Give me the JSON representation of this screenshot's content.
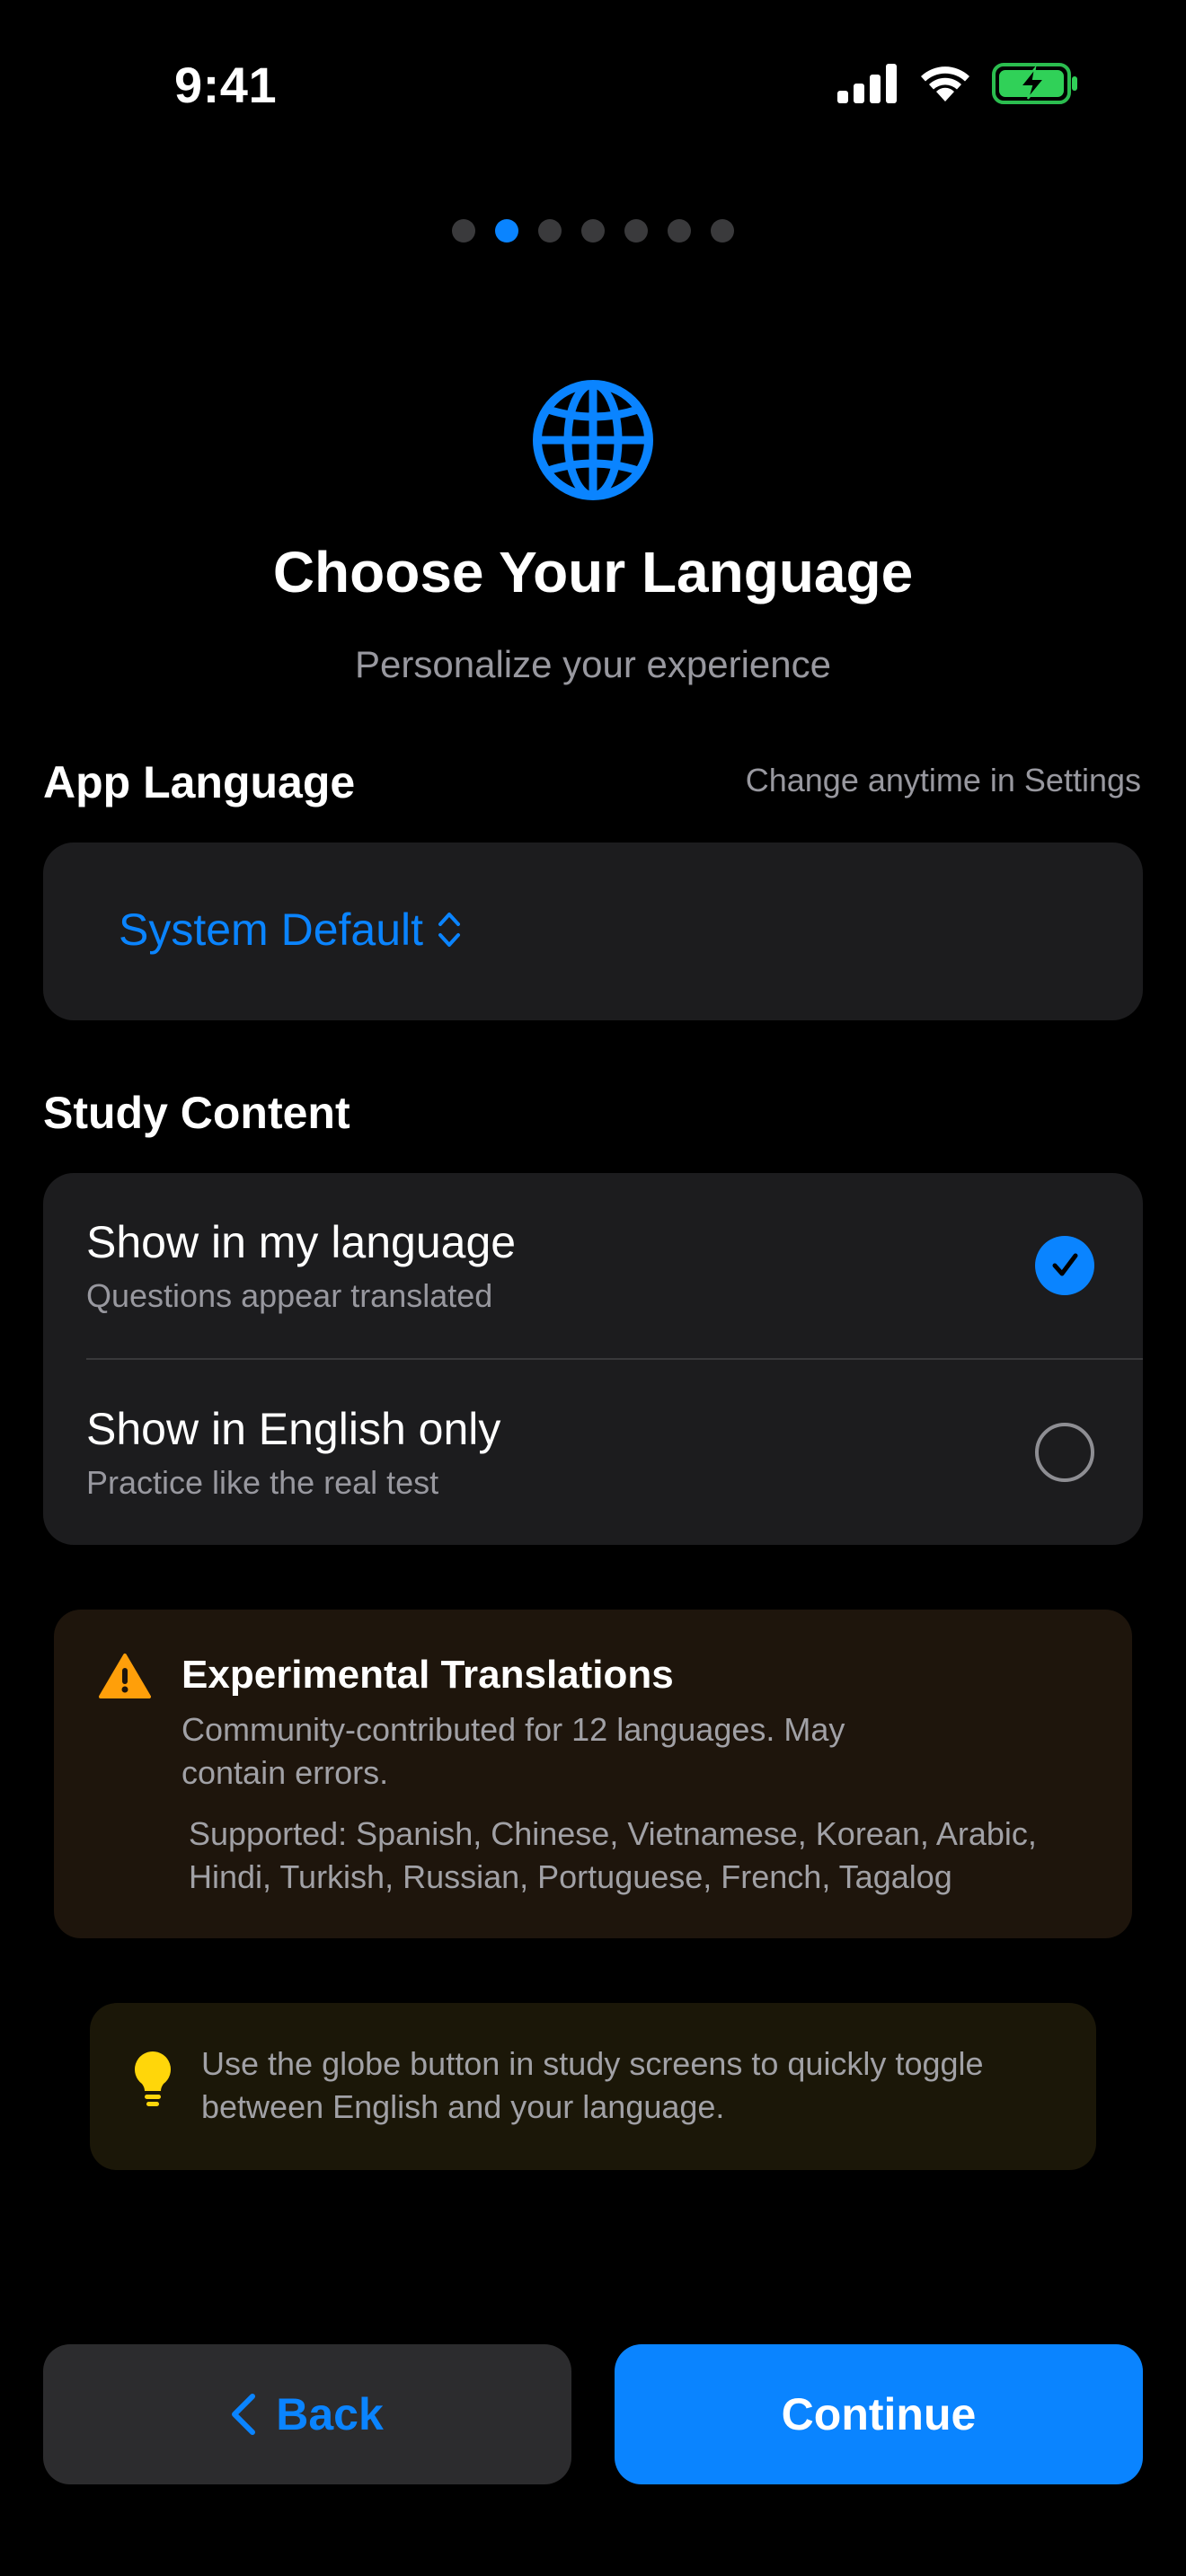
{
  "status_bar": {
    "time": "9:41"
  },
  "pager": {
    "total": 7,
    "active_index": 1
  },
  "header": {
    "title": "Choose Your Language",
    "subtitle": "Personalize your experience",
    "icon": "globe-icon"
  },
  "app_language": {
    "heading": "App Language",
    "note": "Change anytime in Settings",
    "selected_value": "System Default"
  },
  "study_content": {
    "heading": "Study Content",
    "options": [
      {
        "label": "Show in my language",
        "description": "Questions appear translated",
        "selected": true
      },
      {
        "label": "Show in English only",
        "description": "Practice like the real test",
        "selected": false
      }
    ]
  },
  "warning": {
    "title": "Experimental Translations",
    "body": "Community-contributed for 12 languages. May contain errors.",
    "supported": "Supported: Spanish, Chinese, Vietnamese, Korean, Arabic, Hindi, Turkish, Russian, Portuguese, French, Tagalog"
  },
  "tip": {
    "text": "Use the globe button in study screens to quickly toggle between English and your language."
  },
  "buttons": {
    "back_label": "Back",
    "continue_label": "Continue"
  },
  "colors": {
    "accent": "#0a84ff",
    "background": "#000000",
    "card": "#1c1c1e",
    "warning": "#ff9f0a",
    "tip": "#ffd60a",
    "battery": "#30d158"
  }
}
